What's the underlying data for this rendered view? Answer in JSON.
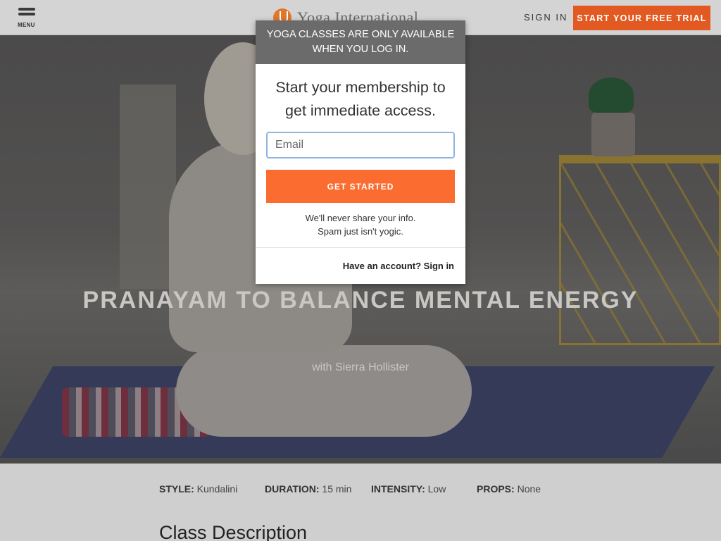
{
  "header": {
    "menu_label": "MENU",
    "logo_text": "Yoga International",
    "signin_label": "SIGN IN",
    "trial_label": "START YOUR FREE TRIAL"
  },
  "hero": {
    "title": "PRANAYAM TO BALANCE MENTAL ENERGY",
    "subtitle": "with Sierra Hollister"
  },
  "modal": {
    "banner": "YOGA CLASSES ARE ONLY AVAILABLE WHEN YOU LOG IN.",
    "lead": "Start your membership to get immediate access.",
    "email_placeholder": "Email",
    "cta_label": "GET STARTED",
    "privacy_line1": "We'll never share your info.",
    "privacy_line2": "Spam just isn't yogic.",
    "account_link": "Have an account? Sign in"
  },
  "details": {
    "style_label": "STYLE:",
    "style_value": "Kundalini",
    "duration_label": "DURATION:",
    "duration_value": "15 min",
    "intensity_label": "INTENSITY:",
    "intensity_value": "Low",
    "props_label": "PROPS:",
    "props_value": "None"
  },
  "section_title": "Class Description",
  "colors": {
    "accent": "#e25a22",
    "cta": "#fa6c30",
    "banner": "#6b6b6c"
  }
}
